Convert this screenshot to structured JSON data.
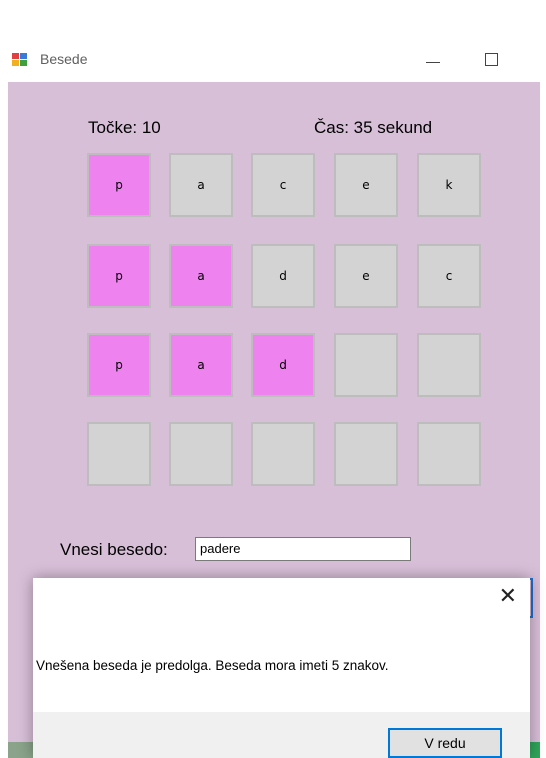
{
  "window": {
    "title": "Besede",
    "icon": "winforms-app-icon",
    "minimize_icon": "minimize-icon",
    "maximize_icon": "maximize-icon"
  },
  "game": {
    "score_label": "Točke: 10",
    "time_label": "Čas: 35 sekund",
    "grid": [
      [
        {
          "letter": "p",
          "hit": true
        },
        {
          "letter": "a",
          "hit": false
        },
        {
          "letter": "c",
          "hit": false
        },
        {
          "letter": "e",
          "hit": false
        },
        {
          "letter": "k",
          "hit": false
        }
      ],
      [
        {
          "letter": "p",
          "hit": true
        },
        {
          "letter": "a",
          "hit": true
        },
        {
          "letter": "d",
          "hit": false
        },
        {
          "letter": "e",
          "hit": false
        },
        {
          "letter": "c",
          "hit": false
        }
      ],
      [
        {
          "letter": "p",
          "hit": true
        },
        {
          "letter": "a",
          "hit": true
        },
        {
          "letter": "d",
          "hit": true
        },
        {
          "letter": "",
          "hit": false
        },
        {
          "letter": "",
          "hit": false
        }
      ],
      [
        {
          "letter": "",
          "hit": false
        },
        {
          "letter": "",
          "hit": false
        },
        {
          "letter": "",
          "hit": false
        },
        {
          "letter": "",
          "hit": false
        },
        {
          "letter": "",
          "hit": false
        }
      ]
    ],
    "input_label": "Vnesi besedo:",
    "input_value": "padere"
  },
  "dialog": {
    "message": "Vnešena beseda je predolga. Beseda mora imeti 5 znakov.",
    "ok_label": "V redu",
    "close_icon": "close-icon"
  },
  "colors": {
    "form_bg": "#d8bfd8",
    "tile_default": "#d3d3d3",
    "tile_hit": "#ee82ee",
    "accent": "#0078d7"
  }
}
